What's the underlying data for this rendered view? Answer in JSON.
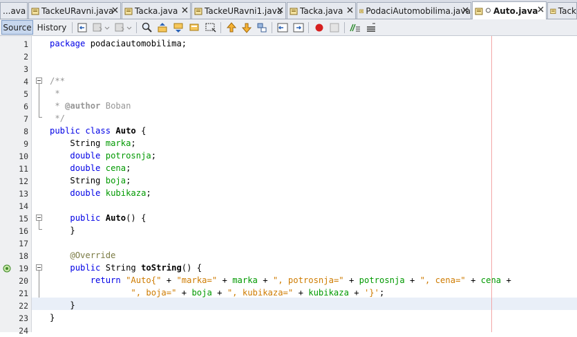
{
  "tabs": [
    {
      "label": "...ava"
    },
    {
      "label": "TackeURavni.java"
    },
    {
      "label": "Tacka.java"
    },
    {
      "label": "TackeURavni1.java"
    },
    {
      "label": "Tacka.java"
    },
    {
      "label": "PodaciAutomobilima.java"
    },
    {
      "label": "Auto.java",
      "active": true
    },
    {
      "label": "Tack"
    }
  ],
  "toolbar": {
    "source_label": "Source",
    "history_label": "History"
  },
  "editor": {
    "line_numbers": [
      "1",
      "2",
      "3",
      "4",
      "5",
      "6",
      "7",
      "8",
      "9",
      "10",
      "11",
      "12",
      "13",
      "14",
      "15",
      "16",
      "17",
      "18",
      "19",
      "20",
      "21",
      "22",
      "23",
      "24"
    ],
    "code": {
      "l1_kw": "package",
      "l1_rest": " podaciautomobilima;",
      "l4": "/**",
      "l5": " *",
      "l6_star": " * ",
      "l6_tag": "@author",
      "l6_name": " Boban",
      "l7": " */",
      "l8_kw": "public class",
      "l8_name": "Auto",
      "l8_brace": " {",
      "l9_type": "String",
      "l9_field": "marka",
      "l10_type": "double",
      "l10_field": "potrosnja",
      "l11_type": "double",
      "l11_field": "cena",
      "l12_type": "String",
      "l12_field": "boja",
      "l13_type": "double",
      "l13_field": "kubikaza",
      "semicolon": ";",
      "l15_kw": "public",
      "l15_name": "Auto",
      "l15_rest": "() {",
      "l16": "}",
      "l18": "@Override",
      "l19_kw": "public",
      "l19_type": " String ",
      "l19_name": "toString",
      "l19_rest": "() {",
      "l20_kw": "return",
      "l20_s1": "\"Auto{\"",
      "l20_s2": "\"marka=\"",
      "l20_s3": "\", potrosnja=\"",
      "l20_s4": "\", cena=\"",
      "plus": " + ",
      "l21_s1": "\", boja=\"",
      "l21_s2": "\", kubikaza=\"",
      "l21_s3": "'}'",
      "l22": "}",
      "l23": "}"
    }
  },
  "colors": {
    "keyword": "#0000e6",
    "field": "#009900",
    "string": "#ce7b00",
    "comment": "#969696",
    "current_line": "#e9eff8",
    "margin_line": "#f2a6a6"
  }
}
